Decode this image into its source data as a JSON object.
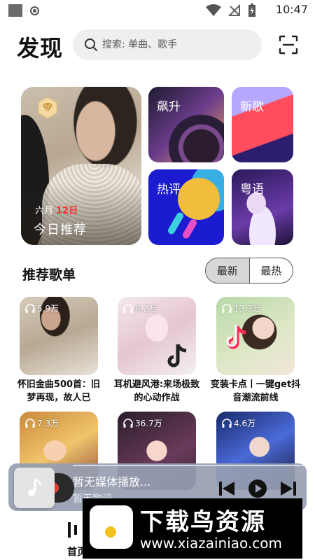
{
  "status_bar": {
    "time": "10:47",
    "icons": [
      "wifi-icon",
      "signal-off-icon",
      "battery-charging-icon"
    ]
  },
  "header": {
    "title": "发现",
    "search_placeholder": "搜索: 单曲、歌手",
    "scan_icon": "scan-icon"
  },
  "hero": {
    "month": "六月",
    "day": "12日",
    "title": "今日推荐",
    "badge_icon": "diamond-icon"
  },
  "tiles": [
    {
      "label": "飙升"
    },
    {
      "label": "新歌"
    },
    {
      "label": "热评"
    },
    {
      "label": "粤语"
    }
  ],
  "section": {
    "title": "推荐歌单",
    "tabs": [
      {
        "label": "最新",
        "active": true
      },
      {
        "label": "最热",
        "active": false
      }
    ]
  },
  "playlists": [
    {
      "count": "5.9万",
      "title": "怀旧金曲500首：旧梦再现，故人已"
    },
    {
      "count": "8.2万",
      "title": "耳机避风港:来场极致的心动作战"
    },
    {
      "count": "13.3万",
      "title": "变装卡点丨一键get抖音潮流前线"
    },
    {
      "count": "7.3万",
      "title": ""
    },
    {
      "count": "36.7万",
      "title": ""
    },
    {
      "count": "4.6万",
      "title": ""
    }
  ],
  "player": {
    "title": "暂无媒体播放...",
    "lyric": "暂无歌词",
    "controls": [
      "previous-icon",
      "play-icon",
      "next-icon"
    ]
  },
  "bottom_nav": {
    "home_label": "首页"
  },
  "watermark": {
    "title": "下载鸟资源",
    "url": "www.xiazainiao.com"
  },
  "colors": {
    "accent_red": "#ff2d2d",
    "player_bg": "#969eb2",
    "tab_active_bg": "#d7d7d7"
  }
}
